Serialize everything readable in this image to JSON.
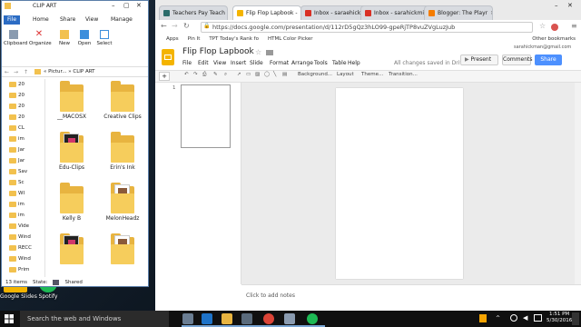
{
  "explorer": {
    "title": "CLIP ART",
    "ribbon_tabs": [
      "File",
      "Home",
      "Share",
      "View",
      "Manage"
    ],
    "ribbon_buttons": [
      "Clipboard",
      "Organize",
      "New",
      "Open",
      "Select"
    ],
    "address": "« Pictur... » CLIP ART",
    "nav_items": [
      "20",
      "20",
      "20",
      "20",
      "CL",
      "im",
      "Jar",
      "Jar",
      "Sav",
      "Sc",
      "WI",
      "im",
      "im",
      "Vide",
      "Wind",
      "RECC",
      "Wind",
      "Prim",
      "TPT (",
      "24",
      "---",
      "---"
    ],
    "files": [
      {
        "name": "__MACOSX",
        "style": "plain"
      },
      {
        "name": "Creative Clips",
        "style": "plain"
      },
      {
        "name": "Edu-Clips",
        "style": "dark"
      },
      {
        "name": "Erin's Ink",
        "style": "plain"
      },
      {
        "name": "Kelly B",
        "style": "plain"
      },
      {
        "name": "MelonHeadz",
        "style": "art"
      },
      {
        "name": "",
        "style": "dark"
      },
      {
        "name": "",
        "style": "art"
      }
    ],
    "status": [
      "13 items",
      "State:",
      "Shared"
    ]
  },
  "desktop_icons": [
    {
      "label": "Google Slides"
    },
    {
      "label": "Spotify"
    }
  ],
  "chrome": {
    "tabs": [
      {
        "label": "Teachers Pay Teach",
        "color": "#2a6b6b"
      },
      {
        "label": "Flip Flop Lapbook -",
        "color": "#f4b400",
        "active": true
      },
      {
        "label": "Inbox - saraehicki",
        "color": "#d93025"
      },
      {
        "label": "Inbox - sarahickmi",
        "color": "#d93025"
      },
      {
        "label": "Blogger: The Playr",
        "color": "#f57c00"
      }
    ],
    "url": "https://docs.google.com/presentation/d/112rD5gQz3hLO99-gpeRjTP8vuZVgLuzJub",
    "bookmarks": [
      "Apps",
      "Pin It",
      "TPT Today's Rank fo",
      "HTML Color Picker"
    ],
    "other_bookmarks": "Other bookmarks"
  },
  "docs": {
    "title": "Flip Flop Lapbook",
    "account": "sarahickman@gmail.com",
    "menu": [
      "File",
      "Edit",
      "View",
      "Insert",
      "Slide",
      "Format",
      "Arrange",
      "Tools",
      "Table",
      "Help"
    ],
    "saved_status": "All changes saved in Drive",
    "present": "Present",
    "comments": "Comments",
    "share": "Share",
    "toolbar": [
      "Background...",
      "Layout",
      "Theme...",
      "Transition..."
    ],
    "slide_number": "1",
    "notes_placeholder": "Click to add notes"
  },
  "taskbar": {
    "search_placeholder": "Search the web and Windows",
    "time": "1:51 PM",
    "date": "5/30/2016"
  }
}
